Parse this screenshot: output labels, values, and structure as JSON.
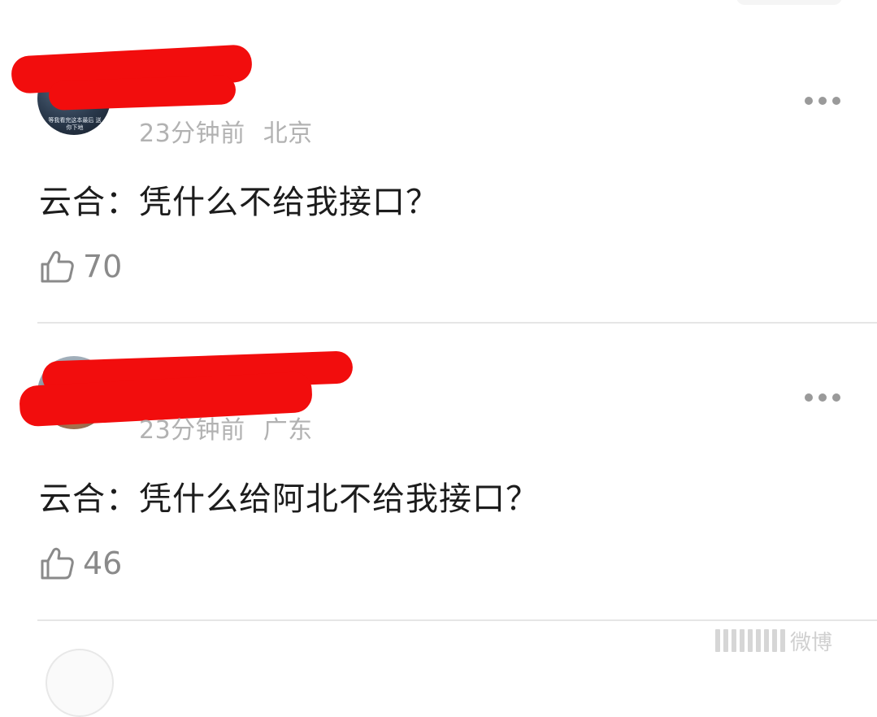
{
  "comments": [
    {
      "avatar_text": "等我看完这本最后 送你下地",
      "time": "23分钟前",
      "location": "北京",
      "text": "云合：凭什么不给我接口？",
      "likes": "70"
    },
    {
      "time": "23分钟前",
      "location": "广东",
      "text": "云合：凭什么给阿北不给我接口？",
      "likes": "46"
    }
  ],
  "icons": {
    "like": "thumbs-up-icon",
    "more": "more-horizontal-icon"
  },
  "colors": {
    "redaction": "#f20d0d",
    "meta_text": "#b2b2b2",
    "body_text": "#1c1c1c",
    "like_count": "#8a8a8a",
    "divider": "#e6e6e6"
  },
  "watermark": {
    "text": "微博"
  }
}
